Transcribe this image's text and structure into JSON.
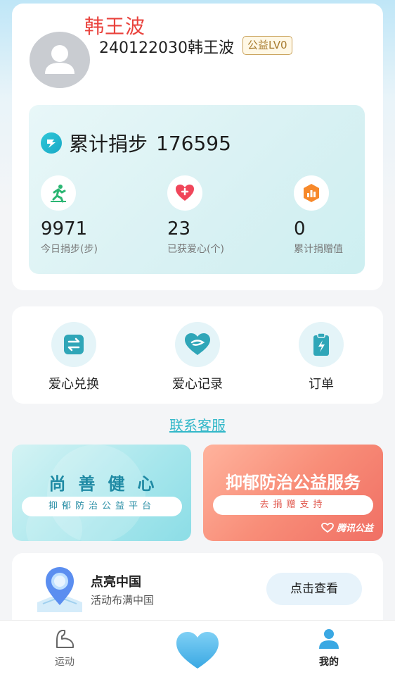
{
  "watermark": "韩王波",
  "profile": {
    "username": "240122030韩王波",
    "level": "公益LV0"
  },
  "stats": {
    "total_label": "累计捐步",
    "total_value": "176595",
    "items": [
      {
        "value": "9971",
        "label": "今日捐步(步)",
        "icon": "running-icon"
      },
      {
        "value": "23",
        "label": "已获爱心(个)",
        "icon": "heart-plus-icon"
      },
      {
        "value": "0",
        "label": "累计捐赠值",
        "icon": "bar-chart-icon"
      }
    ]
  },
  "actions": [
    {
      "label": "爱心兑换",
      "icon": "exchange-icon"
    },
    {
      "label": "爱心记录",
      "icon": "heart-record-icon"
    },
    {
      "label": "订单",
      "icon": "order-icon"
    }
  ],
  "contact_link": "联系客服",
  "banners": {
    "left": {
      "title": "尚善健心",
      "subtitle": "抑郁防治公益平台"
    },
    "right": {
      "title": "抑郁防治公益服务",
      "button": "去捐赠支持",
      "brand": "腾讯公益"
    }
  },
  "lightup": {
    "title": "点亮中国",
    "subtitle": "活动布满中国",
    "button": "点击查看"
  },
  "tabbar": {
    "sport": "运动",
    "mine": "我的"
  },
  "colors": {
    "accent": "#33b8c9",
    "heart_blue": "#4fb6e8",
    "watermark_red": "#e9423c"
  }
}
